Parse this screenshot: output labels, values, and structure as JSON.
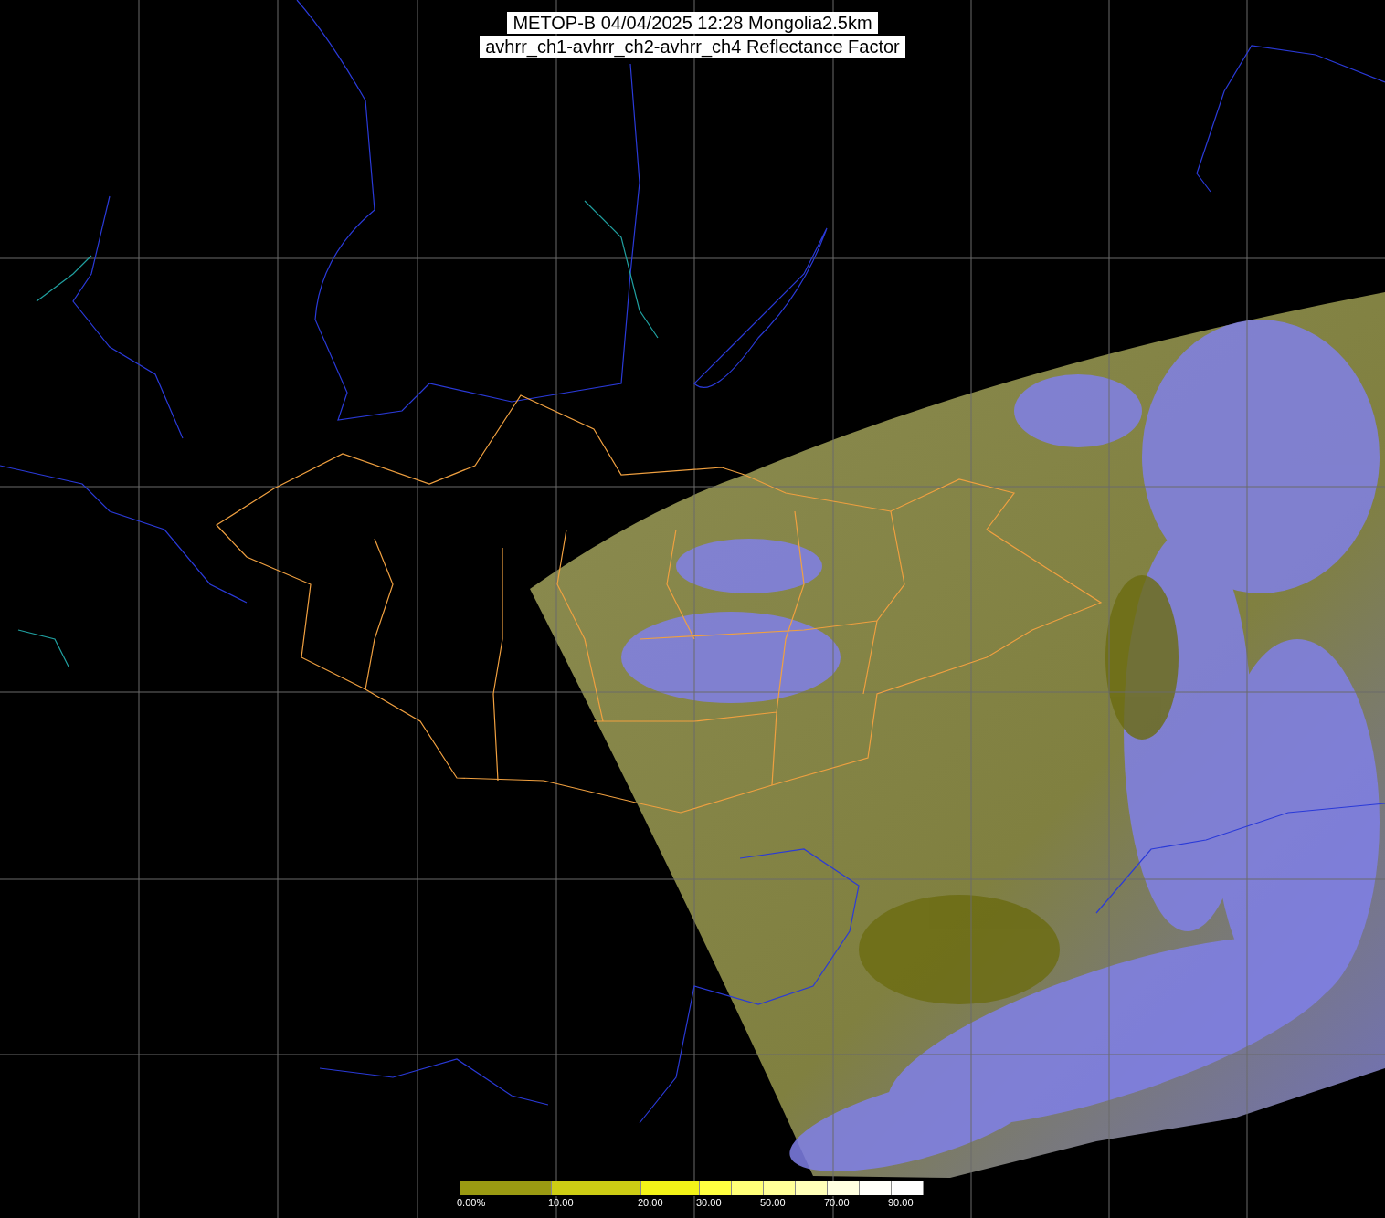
{
  "title_lines": [
    "METOP-B 04/04/2025 12:28 Mongolia2.5km",
    "avhrr_ch1-avhrr_ch2-avhrr_ch4 Reflectance Factor"
  ],
  "colorbar": {
    "segments": [
      {
        "color": "#9a9a12",
        "label": "0.00%"
      },
      {
        "color": "#cccc14",
        "label": "10.00"
      },
      {
        "color": "#f2f218",
        "label": "20.00"
      },
      {
        "color": "#ffff40",
        "label": "30.00"
      },
      {
        "color": "#ffff78"
      },
      {
        "color": "#ffff98",
        "label": "50.00"
      },
      {
        "color": "#ffffb8"
      },
      {
        "color": "#ffffe0",
        "label": "70.00"
      },
      {
        "color": "#fffffa"
      },
      {
        "color": "#fefefe",
        "label": "90.00"
      }
    ]
  }
}
